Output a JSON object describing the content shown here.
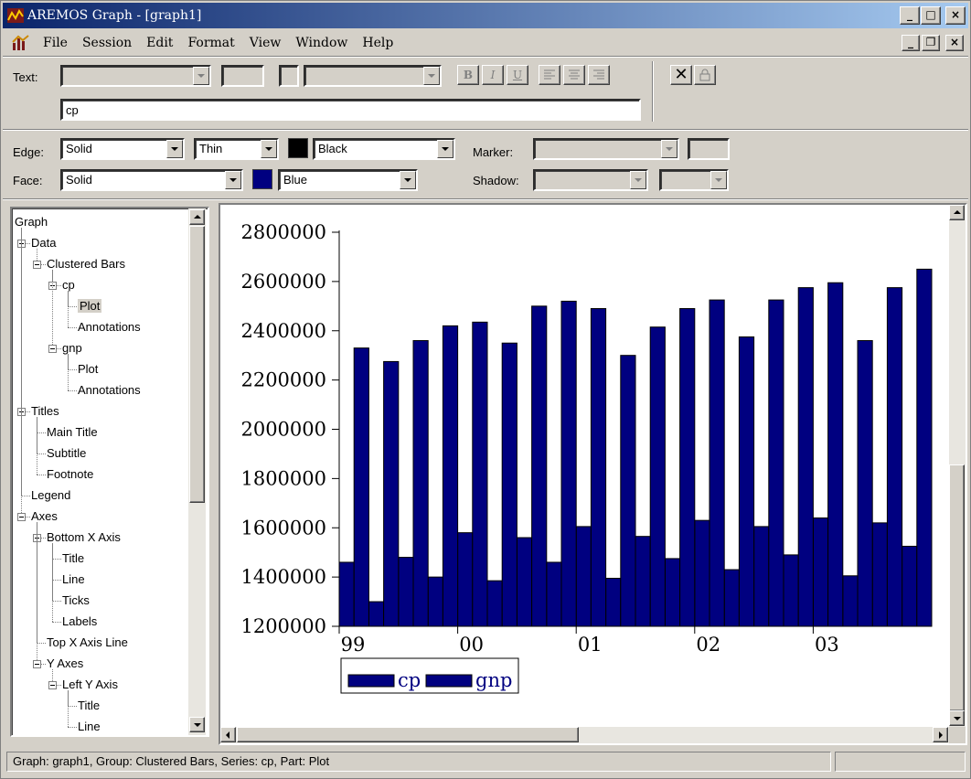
{
  "window": {
    "title": "AREMOS Graph - [graph1]"
  },
  "menu": [
    "File",
    "Session",
    "Edit",
    "Format",
    "View",
    "Window",
    "Help"
  ],
  "text_toolbar": {
    "text_label": "Text:",
    "bold": "B",
    "italic": "I",
    "underline": "U",
    "text_value": "cp"
  },
  "style_toolbar": {
    "edge_label": "Edge:",
    "edge_style": "Solid",
    "edge_width": "Thin",
    "edge_color_name": "Black",
    "edge_color": "#000000",
    "marker_label": "Marker:",
    "face_label": "Face:",
    "face_style": "Solid",
    "face_color_name": "Blue",
    "face_color": "#000080",
    "shadow_label": "Shadow:"
  },
  "tree": {
    "nodes": [
      {
        "label": "Graph",
        "level": 0
      },
      {
        "label": "Data",
        "level": 0
      },
      {
        "label": "Clustered Bars",
        "level": 1
      },
      {
        "label": "cp",
        "level": 2
      },
      {
        "label": "Plot",
        "level": 3,
        "selected": true
      },
      {
        "label": "Annotations",
        "level": 3
      },
      {
        "label": "gnp",
        "level": 2
      },
      {
        "label": "Plot",
        "level": 3
      },
      {
        "label": "Annotations",
        "level": 3
      },
      {
        "label": "Titles",
        "level": 0
      },
      {
        "label": "Main Title",
        "level": 1
      },
      {
        "label": "Subtitle",
        "level": 1
      },
      {
        "label": "Footnote",
        "level": 1
      },
      {
        "label": "Legend",
        "level": 0
      },
      {
        "label": "Axes",
        "level": 0
      },
      {
        "label": "Bottom X Axis",
        "level": 1
      },
      {
        "label": "Title",
        "level": 2
      },
      {
        "label": "Line",
        "level": 2
      },
      {
        "label": "Ticks",
        "level": 2
      },
      {
        "label": "Labels",
        "level": 2
      },
      {
        "label": "Top X Axis Line",
        "level": 1
      },
      {
        "label": "Y Axes",
        "level": 1
      },
      {
        "label": "Left Y Axis",
        "level": 2
      },
      {
        "label": "Title",
        "level": 3
      },
      {
        "label": "Line",
        "level": 3
      }
    ]
  },
  "chart_data": {
    "type": "bar",
    "bar_color": "#000080",
    "ylim": [
      1200000,
      2800000
    ],
    "yticks": [
      "2800000",
      "2600000",
      "2400000",
      "2200000",
      "2000000",
      "1800000",
      "1600000",
      "1400000",
      "1200000"
    ],
    "xtick_labels": [
      "99",
      "00",
      "01",
      "02",
      "03"
    ],
    "legend": [
      "cp",
      "gnp"
    ],
    "series": [
      {
        "name": "cp",
        "values": [
          1460000,
          1300000,
          1480000,
          1400000,
          1580000,
          1385000,
          1560000,
          1460000,
          1605000,
          1395000,
          1565000,
          1475000,
          1630000,
          1430000,
          1605000,
          1490000,
          1640000,
          1405000,
          1620000,
          1525000
        ]
      },
      {
        "name": "gnp",
        "values": [
          2330000,
          2275000,
          2360000,
          2420000,
          2435000,
          2350000,
          2500000,
          2520000,
          2490000,
          2300000,
          2415000,
          2490000,
          2525000,
          2375000,
          2525000,
          2575000,
          2595000,
          2360000,
          2575000,
          2650000
        ]
      }
    ]
  },
  "status": "Graph: graph1, Group: Clustered Bars, Series: cp, Part: Plot"
}
